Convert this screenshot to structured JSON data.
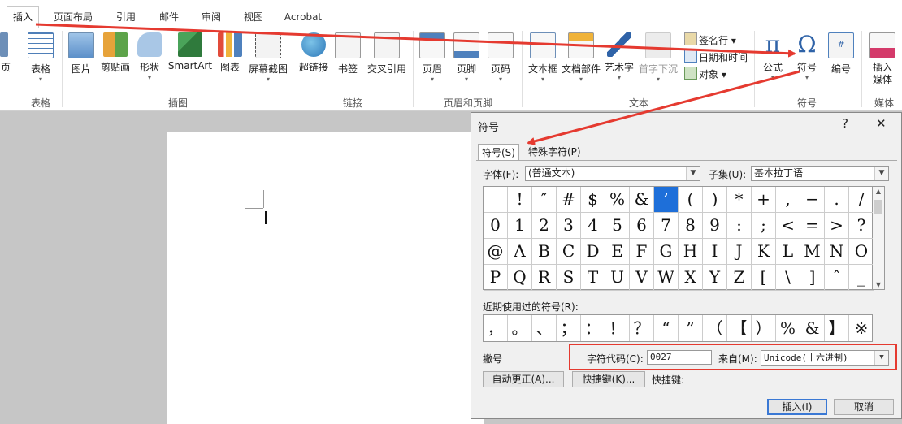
{
  "ribbon_tabs": [
    "插入",
    "页面布局",
    "引用",
    "邮件",
    "审阅",
    "视图",
    "Acrobat"
  ],
  "active_tab": "插入",
  "groups": {
    "page_partial": "页",
    "table": {
      "label": "表格",
      "btn": "表格"
    },
    "illustrations": {
      "label": "插图",
      "btns": [
        "图片",
        "剪贴画",
        "形状",
        "SmartArt",
        "图表",
        "屏幕截图"
      ]
    },
    "links": {
      "label": "链接",
      "btns": [
        "超链接",
        "书签",
        "交叉引用"
      ]
    },
    "header_footer": {
      "label": "页眉和页脚",
      "btns": [
        "页眉",
        "页脚",
        "页码"
      ]
    },
    "text": {
      "label": "文本",
      "btns": [
        "文本框",
        "文档部件",
        "艺术字",
        "首字下沉"
      ],
      "small": [
        "签名行",
        "日期和时间",
        "对象"
      ]
    },
    "symbols": {
      "label": "符号",
      "btns": [
        "公式",
        "符号",
        "编号"
      ]
    },
    "media": {
      "label": "媒体",
      "btn": "插入媒体"
    }
  },
  "colors": {
    "accent": "#1e6fd9",
    "annotation_red": "#e53a30",
    "ribbon_bg": "#ffffff",
    "doc_bg": "#c6c6c6"
  },
  "dialog": {
    "title": "符号",
    "help": "?",
    "close": "✕",
    "tab_symbols": "符号(S)",
    "tab_special": "特殊字符(P)",
    "font_label": "字体(F):",
    "font_value": "(普通文本)",
    "subset_label": "子集(U):",
    "subset_value": "基本拉丁语",
    "grid": [
      [
        " ",
        "!",
        "″",
        "#",
        "$",
        "%",
        "&",
        "’",
        "(",
        ")",
        "*",
        "+",
        ",",
        "−",
        ".",
        "/"
      ],
      [
        "0",
        "1",
        "2",
        "3",
        "4",
        "5",
        "6",
        "7",
        "8",
        "9",
        ":",
        ";",
        "<",
        "=",
        ">",
        "?"
      ],
      [
        "@",
        "A",
        "B",
        "C",
        "D",
        "E",
        "F",
        "G",
        "H",
        "I",
        "J",
        "K",
        "L",
        "M",
        "N",
        "O"
      ],
      [
        "P",
        "Q",
        "R",
        "S",
        "T",
        "U",
        "V",
        "W",
        "X",
        "Y",
        "Z",
        "[",
        "\\",
        "]",
        "ˆ",
        "_"
      ]
    ],
    "selected_cell": {
      "row": 0,
      "col": 7
    },
    "recent_label": "近期使用过的符号(R):",
    "recent": [
      "，",
      "。",
      "、",
      "；",
      "：",
      "！",
      "？",
      "“",
      "”",
      "（",
      "【",
      "）",
      "%",
      "&",
      "】",
      "※"
    ],
    "name_label": "撇号",
    "char_code_label": "字符代码(C):",
    "char_code_value": "0027",
    "from_label": "来自(M):",
    "from_value": "Unicode(十六进制)",
    "autocorrect_btn": "自动更正(A)...",
    "shortcut_btn": "快捷键(K)...",
    "shortcut_label": "快捷键:",
    "insert_btn": "插入(I)",
    "cancel_btn": "取消"
  }
}
